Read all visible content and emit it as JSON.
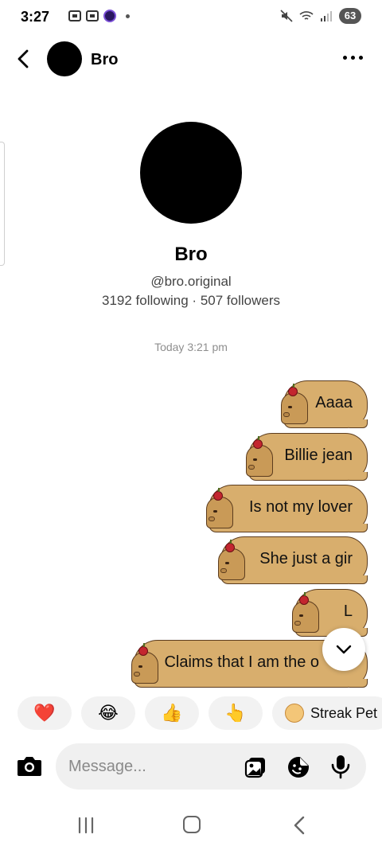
{
  "status_bar": {
    "time": "3:27",
    "battery": "63",
    "icons": [
      "screenshot-icon",
      "screen-record-icon",
      "app-notification-icon",
      "mute-icon",
      "wifi-icon",
      "signal-icon"
    ]
  },
  "header": {
    "name": "Bro",
    "icons": [
      "back-icon",
      "more-icon"
    ]
  },
  "profile": {
    "name": "Bro",
    "handle": "@bro.original",
    "stats": "3192 following · 507 followers"
  },
  "conversation": {
    "timestamp": "Today 3:21 pm",
    "messages": [
      {
        "text": "Aaaa",
        "sender": "me"
      },
      {
        "text": "Billie jean",
        "sender": "me"
      },
      {
        "text": "Is not my lover",
        "sender": "me"
      },
      {
        "text": "She just a gir",
        "sender": "me"
      },
      {
        "text": "L",
        "sender": "me"
      },
      {
        "text": "Claims that I am the o",
        "sender": "me"
      }
    ],
    "bubble_color": "#d8ae6d"
  },
  "quick_reactions": {
    "items": [
      "❤️",
      "😂",
      "👍",
      "👆"
    ],
    "streak_label": "Streak Pet"
  },
  "composer": {
    "placeholder": "Message...",
    "icons": [
      "camera-icon",
      "gallery-icon",
      "sticker-icon",
      "microphone-icon"
    ]
  },
  "nav_bar": {
    "icons": [
      "recent-apps-icon",
      "home-icon",
      "system-back-icon"
    ]
  }
}
